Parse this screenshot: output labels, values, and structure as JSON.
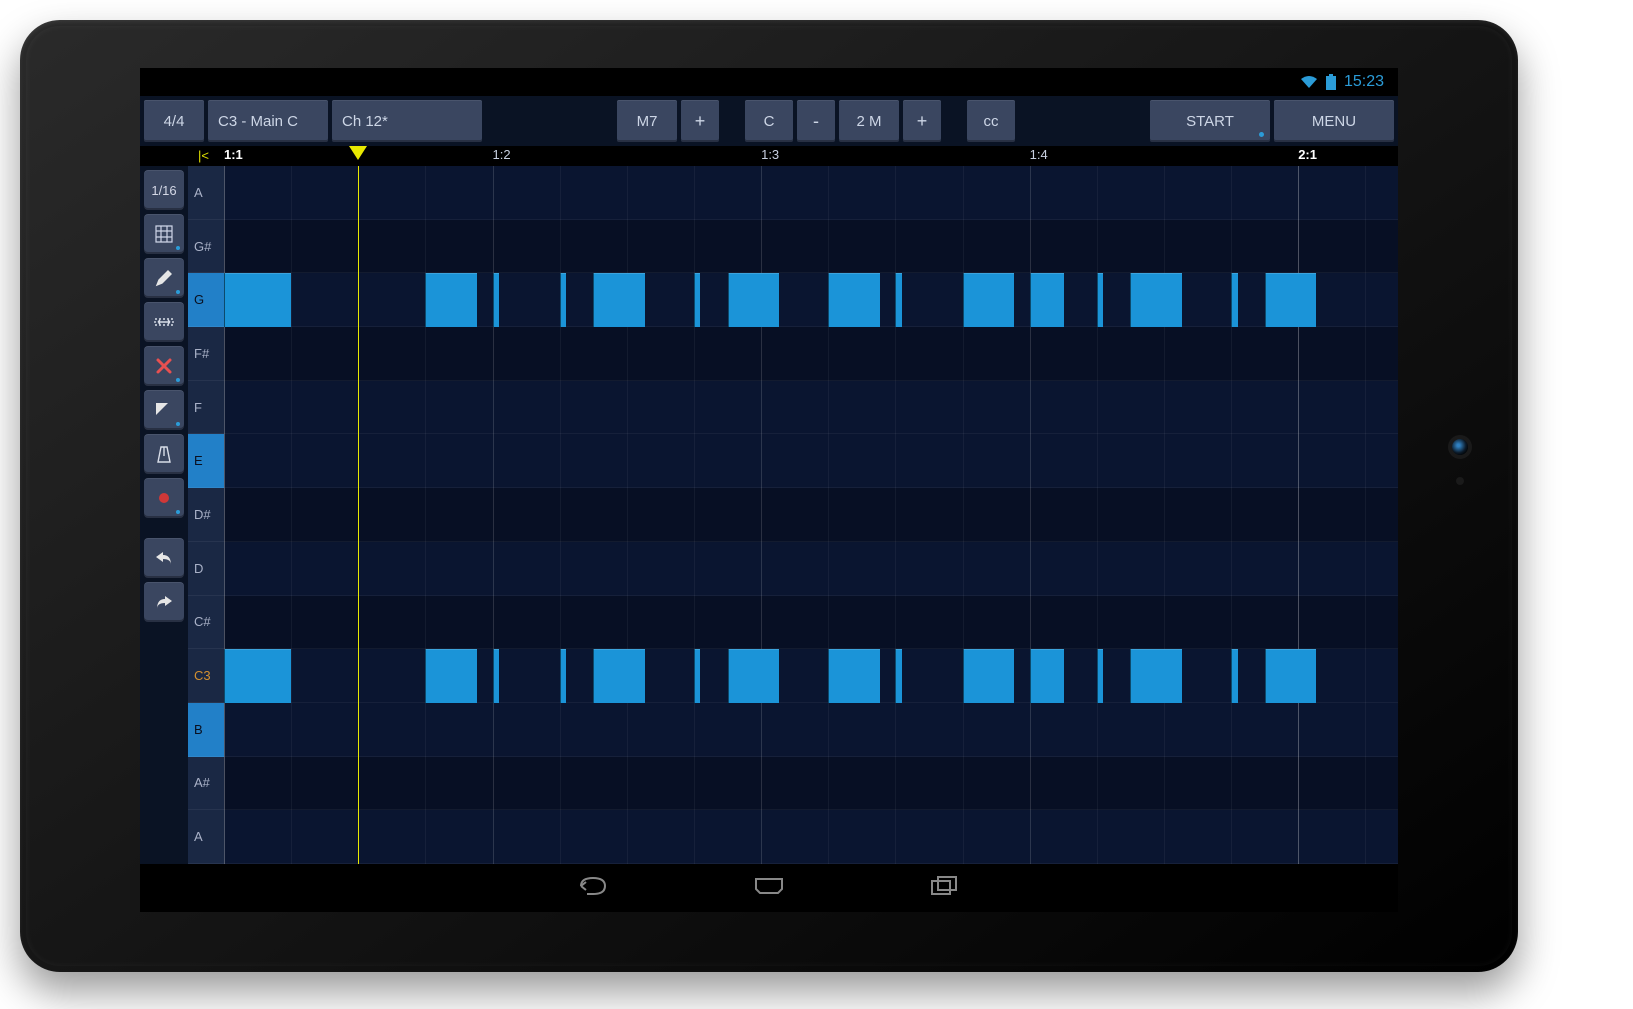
{
  "status": {
    "time": "15:23"
  },
  "toolbar": {
    "time_sig": "4/4",
    "track": "C3 - Main C",
    "channel": "Ch 12*",
    "chord": "M7",
    "chord_plus": "+",
    "key": "C",
    "transpose_minus": "-",
    "transpose_val": "2 M",
    "transpose_plus": "+",
    "cc": "cc",
    "start": "START",
    "menu": "MENU"
  },
  "ruler": {
    "rewind": "|<",
    "labels": [
      {
        "text": "1:1",
        "pos": 0.0,
        "bold": true
      },
      {
        "text": "1:2",
        "pos": 0.25,
        "bold": false
      },
      {
        "text": "1:3",
        "pos": 0.5,
        "bold": false
      },
      {
        "text": "1:4",
        "pos": 0.75,
        "bold": false
      },
      {
        "text": "2:1",
        "pos": 1.0,
        "bold": true
      }
    ],
    "playhead": 0.125
  },
  "tools": {
    "quantize": "1/16"
  },
  "keys": [
    {
      "name": "A",
      "black": false
    },
    {
      "name": "G#",
      "black": true
    },
    {
      "name": "G",
      "black": false,
      "hl": true
    },
    {
      "name": "F#",
      "black": true
    },
    {
      "name": "F",
      "black": false
    },
    {
      "name": "E",
      "black": false,
      "hl": true
    },
    {
      "name": "D#",
      "black": true
    },
    {
      "name": "D",
      "black": false
    },
    {
      "name": "C#",
      "black": true
    },
    {
      "name": "C3",
      "black": false,
      "root": true
    },
    {
      "name": "B",
      "black": false,
      "hl": true
    },
    {
      "name": "A#",
      "black": true
    },
    {
      "name": "A",
      "black": false
    }
  ],
  "notes_g": [
    {
      "start": 0.0,
      "len": 0.062
    },
    {
      "start": 0.1875,
      "len": 0.048
    },
    {
      "start": 0.25,
      "len": 0.006
    },
    {
      "start": 0.3125,
      "len": 0.006
    },
    {
      "start": 0.34375,
      "len": 0.048
    },
    {
      "start": 0.4375,
      "len": 0.006
    },
    {
      "start": 0.46875,
      "len": 0.048
    },
    {
      "start": 0.5625,
      "len": 0.048
    },
    {
      "start": 0.625,
      "len": 0.006
    },
    {
      "start": 0.6875,
      "len": 0.048
    },
    {
      "start": 0.75,
      "len": 0.032
    },
    {
      "start": 0.8125,
      "len": 0.006
    },
    {
      "start": 0.84375,
      "len": 0.048
    },
    {
      "start": 0.9375,
      "len": 0.006
    },
    {
      "start": 0.96875,
      "len": 0.048
    }
  ],
  "notes_c": [
    {
      "start": 0.0,
      "len": 0.062
    },
    {
      "start": 0.1875,
      "len": 0.048
    },
    {
      "start": 0.25,
      "len": 0.006
    },
    {
      "start": 0.3125,
      "len": 0.006
    },
    {
      "start": 0.34375,
      "len": 0.048
    },
    {
      "start": 0.4375,
      "len": 0.006
    },
    {
      "start": 0.46875,
      "len": 0.048
    },
    {
      "start": 0.5625,
      "len": 0.048
    },
    {
      "start": 0.625,
      "len": 0.006
    },
    {
      "start": 0.6875,
      "len": 0.048
    },
    {
      "start": 0.75,
      "len": 0.032
    },
    {
      "start": 0.8125,
      "len": 0.006
    },
    {
      "start": 0.84375,
      "len": 0.048
    },
    {
      "start": 0.9375,
      "len": 0.006
    },
    {
      "start": 0.96875,
      "len": 0.048
    }
  ],
  "grid": {
    "subdivisions": 16,
    "row_g_index": 2,
    "row_c_index": 9
  }
}
